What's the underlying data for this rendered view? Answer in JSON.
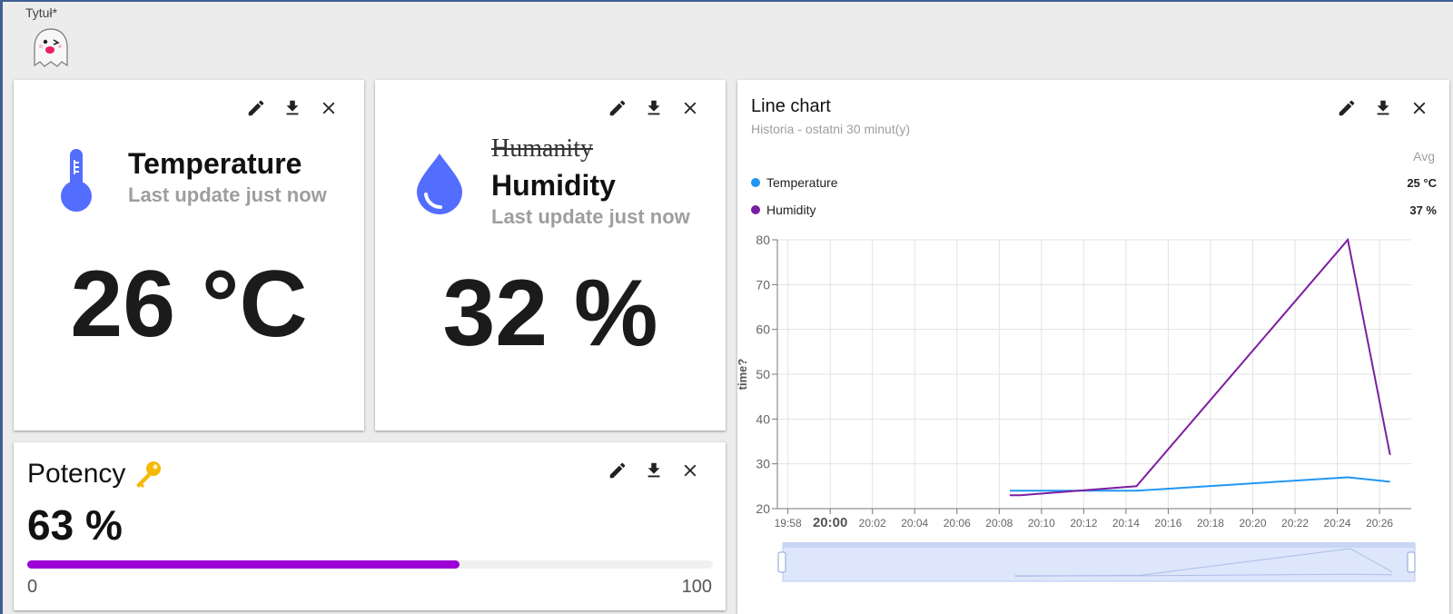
{
  "page": {
    "title": "Tytuł*"
  },
  "tools": {
    "edit": "pencil-icon",
    "download": "download-icon",
    "close": "close-icon"
  },
  "temperature": {
    "title": "Temperature",
    "subtitle": "Last update just now",
    "value": "26 °C",
    "icon": "thermometer-icon",
    "icon_color": "#536dfe"
  },
  "humidity": {
    "struck_title": "Humanity",
    "title": "Humidity",
    "subtitle": "Last update just now",
    "value": "32 %",
    "icon": "water-drop-icon",
    "icon_color": "#536dfe"
  },
  "potency": {
    "title": "Potency",
    "icon": "key-icon",
    "value": "63 %",
    "percent": 63,
    "min": "0",
    "max": "100",
    "bar_color": "#9c00d6"
  },
  "line_chart": {
    "title": "Line chart",
    "subtitle": "Historia - ostatni 30 minut(y)",
    "avg_label": "Avg",
    "legend": [
      {
        "name": "Temperature",
        "avg": "25 °C",
        "color": "#2196f3"
      },
      {
        "name": "Humidity",
        "avg": "37 %",
        "color": "#7b1fa2"
      }
    ]
  },
  "chart_data": {
    "type": "line",
    "ylabel": "time?",
    "ylim": [
      20,
      80
    ],
    "yticks": [
      20,
      30,
      40,
      50,
      60,
      70,
      80
    ],
    "xlim": [
      "19:57.5",
      "20:27.5"
    ],
    "xticks": [
      "19:58",
      "20:00",
      "20:02",
      "20:04",
      "20:06",
      "20:08",
      "20:10",
      "20:12",
      "20:14",
      "20:16",
      "20:18",
      "20:20",
      "20:22",
      "20:24",
      "20:26"
    ],
    "bold_tick": "20:00",
    "grid": true,
    "series": [
      {
        "name": "Temperature",
        "color": "#2196f3",
        "x": [
          "20:08.5",
          "20:14.5",
          "20:24.5",
          "20:26.5"
        ],
        "y": [
          24,
          24,
          27,
          26
        ]
      },
      {
        "name": "Humidity",
        "color": "#7b1fa2",
        "x": [
          "20:08.5",
          "20:09",
          "20:14.5",
          "20:24.5",
          "20:26.5"
        ],
        "y": [
          23,
          23,
          25,
          80,
          32
        ]
      }
    ]
  }
}
